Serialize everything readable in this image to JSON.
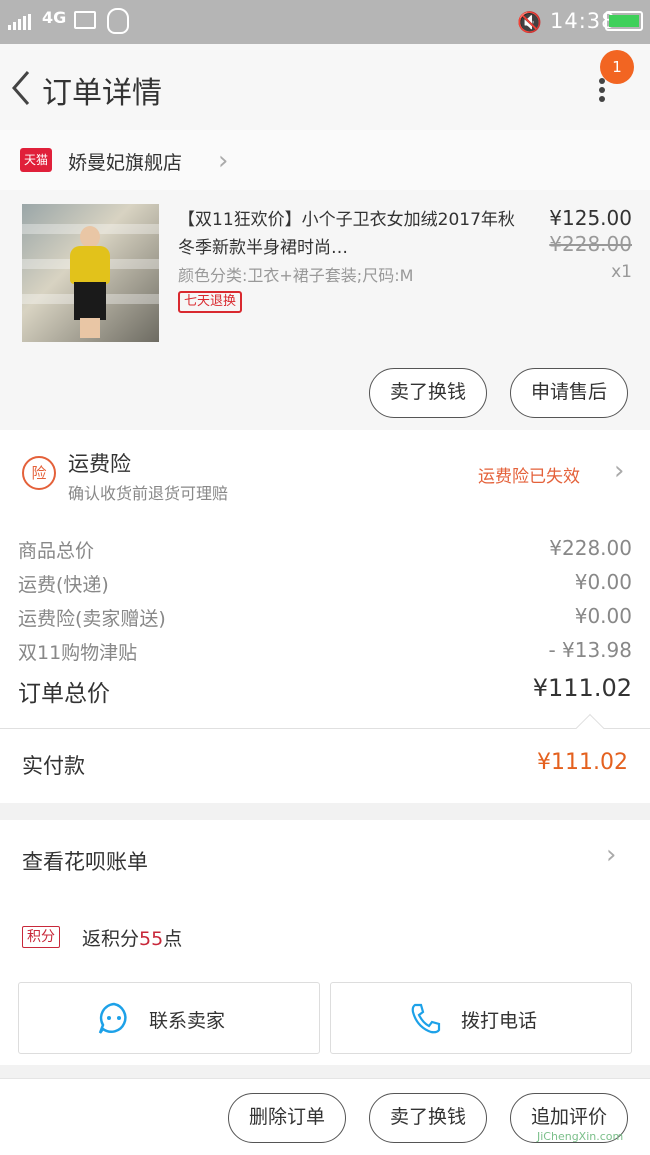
{
  "status_bar": {
    "network": "4G",
    "time": "14:38"
  },
  "nav": {
    "title": "订单详情",
    "badge_count": "1"
  },
  "shop": {
    "platform_badge": "天猫",
    "name": "娇曼妃旗舰店"
  },
  "item": {
    "title": "【双11狂欢价】小个子卫衣女加绒2017年秋冬季新款半身裙时尚…",
    "sku": "颜色分类:卫衣+裙子套装;尺码:M",
    "tag": "七天退换",
    "price": "¥125.00",
    "original_price": "¥228.00",
    "quantity": "x1",
    "buttons": [
      "卖了换钱",
      "申请售后"
    ]
  },
  "insurance": {
    "icon_text": "险",
    "title": "运费险",
    "subtitle": "确认收货前退货可理赔",
    "status": "运费险已失效"
  },
  "summary": {
    "rows": [
      {
        "label": "商品总价",
        "value": "¥228.00"
      },
      {
        "label": "运费(快递)",
        "value": "¥0.00"
      },
      {
        "label": "运费险(卖家赠送)",
        "value": "¥0.00"
      },
      {
        "label": "双11购物津贴",
        "value": "- ¥13.98"
      }
    ],
    "total_label": "订单总价",
    "total_value": "¥111.02"
  },
  "payment": {
    "label": "实付款",
    "value": "¥111.02"
  },
  "bill": {
    "label": "查看花呗账单"
  },
  "points": {
    "tag": "积分",
    "prefix": "返积分",
    "count": "55",
    "suffix": "点"
  },
  "contact": {
    "chat_label": "联系卖家",
    "call_label": "拨打电话"
  },
  "bottom_bar": {
    "buttons": [
      "删除订单",
      "卖了换钱",
      "追加评价"
    ]
  },
  "watermark": "JiChengXin.com",
  "colors": {
    "accent_orange": "#e4611f",
    "tmall_red": "#e0203a",
    "badge_orange": "#f26522",
    "link_blue": "#1da1e8"
  }
}
